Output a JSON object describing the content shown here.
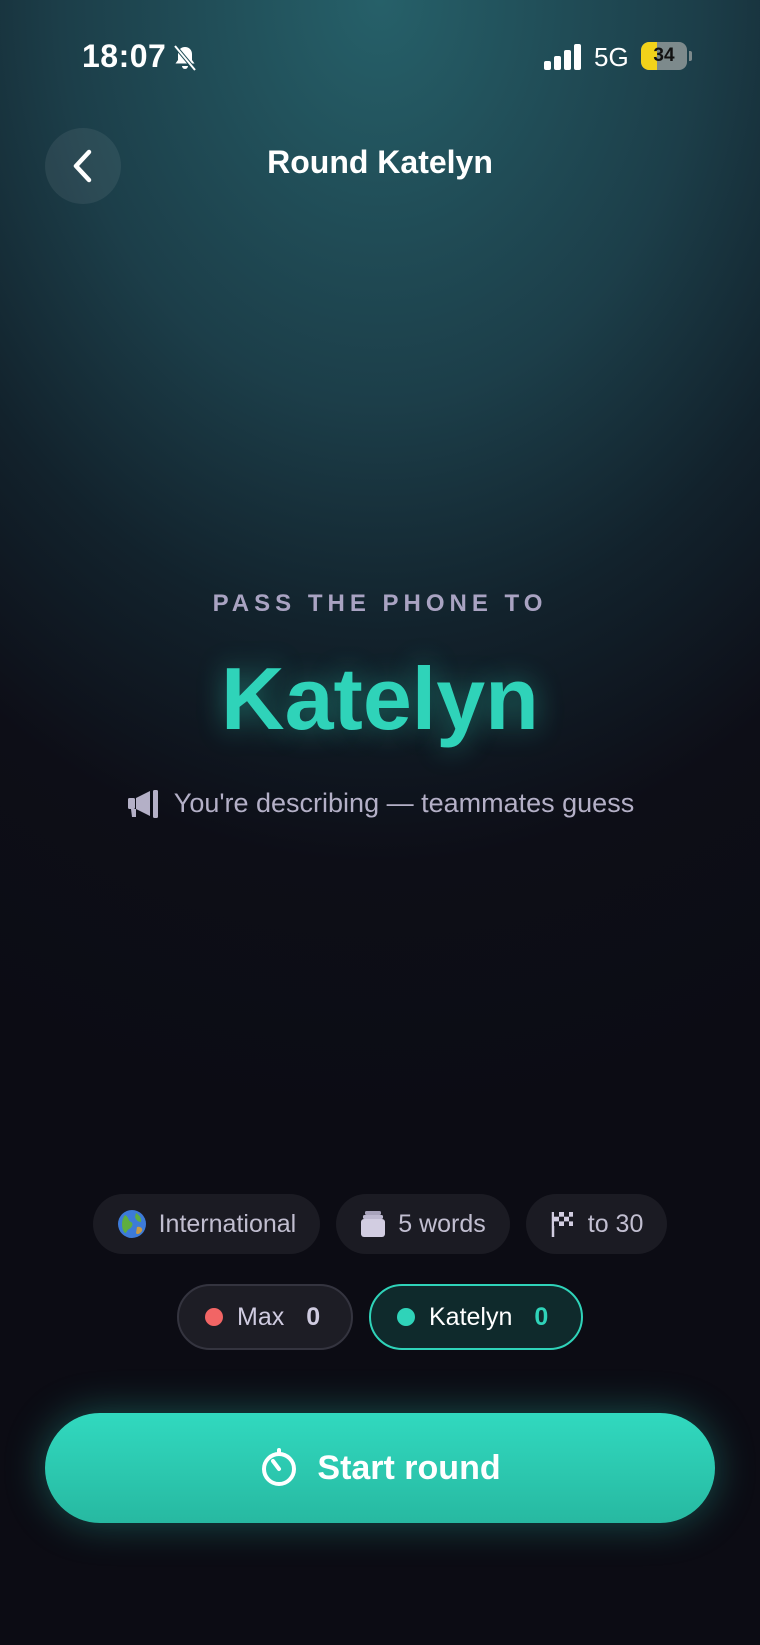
{
  "status_bar": {
    "time": "18:07",
    "network": "5G",
    "battery": "34",
    "battery_level": 0.34
  },
  "header": {
    "title": "Round Katelyn",
    "back_icon": "chevron-left-icon"
  },
  "prompt": {
    "kicker": "PASS THE PHONE TO",
    "player": "Katelyn",
    "hint": "You're describing — teammates guess",
    "hint_icon": "megaphone-icon"
  },
  "chips": [
    {
      "icon": "globe-icon",
      "label": "International"
    },
    {
      "icon": "card-stack-icon",
      "label": "5 words"
    },
    {
      "icon": "checkered-flag-icon",
      "label": "to 30"
    }
  ],
  "teams": [
    {
      "name": "Max",
      "score": "0",
      "color": "#f26565",
      "active": false
    },
    {
      "name": "Katelyn",
      "score": "0",
      "color": "#2fd3b9",
      "active": true
    }
  ],
  "start_button": {
    "label": "Start round",
    "icon": "timer-icon"
  },
  "colors": {
    "accent": "#2fd3b9",
    "danger": "#f26565"
  }
}
